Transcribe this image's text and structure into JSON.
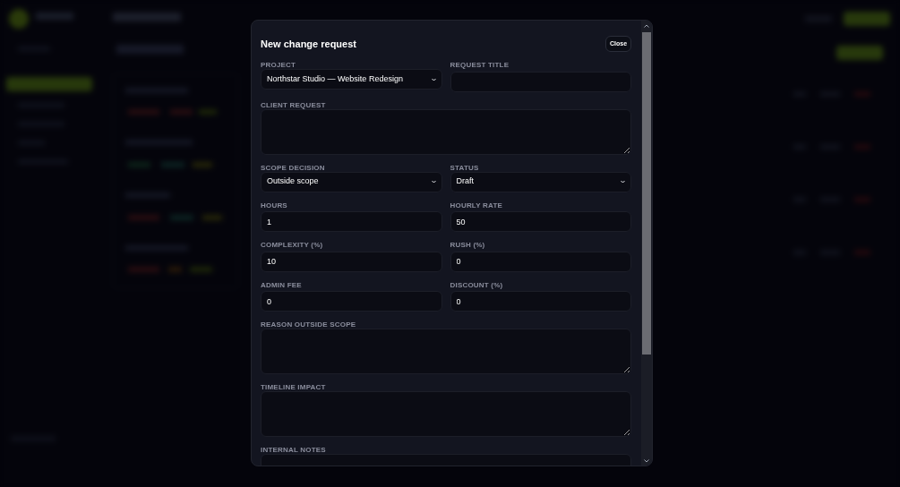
{
  "modal": {
    "title": "New change request",
    "close_button": "Close",
    "fields": [
      {
        "kind": "select",
        "label": "PROJECT",
        "value": "Northstar Studio — Website Redesign"
      },
      {
        "kind": "input",
        "label": "REQUEST TITLE"
      },
      {
        "kind": "textarea",
        "label": "CLIENT REQUEST"
      },
      {
        "kind": "select",
        "label": "SCOPE DECISION",
        "value": "Outside scope"
      },
      {
        "kind": "select",
        "label": "STATUS",
        "value": "Draft"
      },
      {
        "kind": "input",
        "label": "HOURS",
        "value": "1"
      },
      {
        "kind": "input",
        "label": "HOURLY RATE",
        "value": "50"
      },
      {
        "kind": "input",
        "label": "COMPLEXITY (%)",
        "value": "10"
      },
      {
        "kind": "input",
        "label": "RUSH (%)",
        "value": "0"
      },
      {
        "kind": "input",
        "label": "ADMIN FEE",
        "value": "0"
      },
      {
        "kind": "input",
        "label": "DISCOUNT (%)",
        "value": "0"
      },
      {
        "kind": "textarea",
        "label": "REASON OUTSIDE SCOPE"
      },
      {
        "kind": "textarea",
        "label": "TIMELINE IMPACT"
      },
      {
        "kind": "textarea",
        "label": "INTERNAL NOTES"
      }
    ]
  }
}
